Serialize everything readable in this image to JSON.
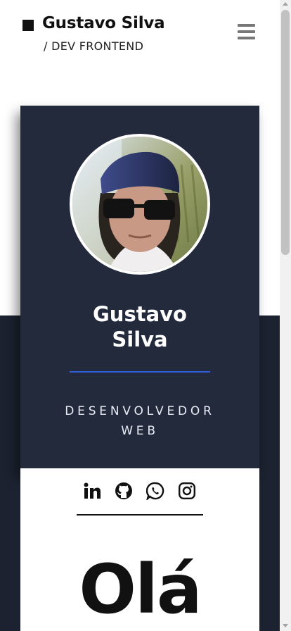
{
  "header": {
    "name": "Gustavo Silva",
    "subtitle": "/ DEV FRONTEND"
  },
  "profile": {
    "name_line1": "Gustavo",
    "name_line2": "Silva",
    "role_line1": "DESENVOLVEDOR",
    "role_line2": "WEB",
    "accent_color": "#2f5fd6",
    "card_color": "#222a3c"
  },
  "social": {
    "icons": [
      "linkedin-icon",
      "github-icon",
      "whatsapp-icon",
      "instagram-icon"
    ]
  },
  "main": {
    "greeting": "Olá"
  }
}
